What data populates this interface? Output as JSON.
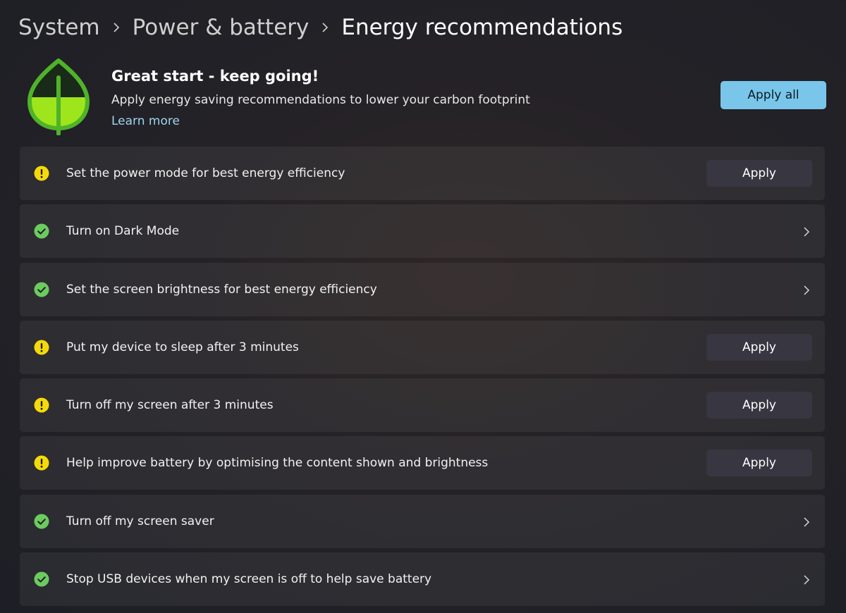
{
  "breadcrumb": {
    "items": [
      "System",
      "Power & battery"
    ],
    "current": "Energy recommendations"
  },
  "hero": {
    "icon": "leaf-icon",
    "title": "Great start - keep going!",
    "subtitle": "Apply energy saving recommendations to lower your carbon footprint",
    "link": "Learn more",
    "apply_all_label": "Apply all"
  },
  "recommendations": [
    {
      "label": "Set the power mode for best energy efficiency",
      "status": "warning",
      "action": "Apply"
    },
    {
      "label": "Turn on Dark Mode",
      "status": "done",
      "action": "chevron"
    },
    {
      "label": "Set the screen brightness for best energy efficiency",
      "status": "done",
      "action": "chevron"
    },
    {
      "label": "Put my device to sleep after 3 minutes",
      "status": "warning",
      "action": "Apply"
    },
    {
      "label": "Turn off my screen after 3 minutes",
      "status": "warning",
      "action": "Apply"
    },
    {
      "label": "Help improve battery by optimising the content shown and brightness",
      "status": "warning",
      "action": "Apply"
    },
    {
      "label": "Turn off my screen saver",
      "status": "done",
      "action": "chevron"
    },
    {
      "label": "Stop USB devices when my screen is off to help save battery",
      "status": "done",
      "action": "chevron"
    }
  ],
  "colors": {
    "accent": "#79c6ea",
    "warning": "#f5d90a",
    "done": "#6ccb5f",
    "leaf_fill": "#9ee51b",
    "leaf_outline": "#4fb32a"
  }
}
